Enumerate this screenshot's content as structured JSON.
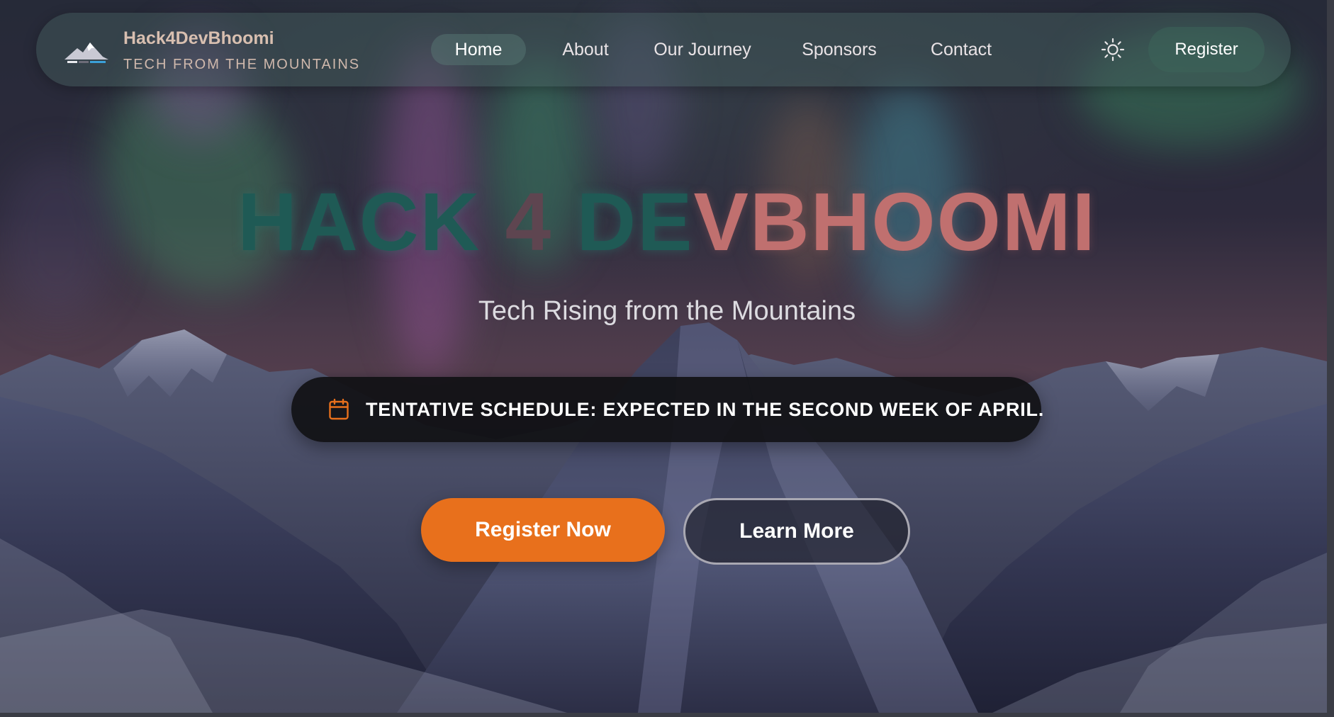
{
  "brand": {
    "title": "Hack4DevBhoomi",
    "subtitle": "TECH FROM THE MOUNTAINS",
    "logo_icon": "mountain-logo-icon"
  },
  "nav": {
    "items": [
      {
        "label": "Home",
        "active": true
      },
      {
        "label": "About",
        "active": false
      },
      {
        "label": "Our Journey",
        "active": false
      },
      {
        "label": "Sponsors",
        "active": false
      },
      {
        "label": "Contact",
        "active": false
      }
    ],
    "theme_toggle_icon": "sun-icon",
    "register_label": "Register"
  },
  "hero": {
    "title_parts": [
      "HACK",
      "4",
      "DE",
      "VBHOOMI"
    ],
    "subtitle": "Tech Rising from the Mountains",
    "schedule_icon": "calendar-icon",
    "schedule_text": "TENTATIVE SCHEDULE: EXPECTED IN THE SECOND WEEK OF APRIL.",
    "primary_button": "Register Now",
    "secondary_button": "Learn More"
  },
  "colors": {
    "accent_orange": "#e8701c",
    "title_teal": "#1f5a55",
    "title_rose": "#c0706f",
    "pill_dark": "#111114"
  }
}
